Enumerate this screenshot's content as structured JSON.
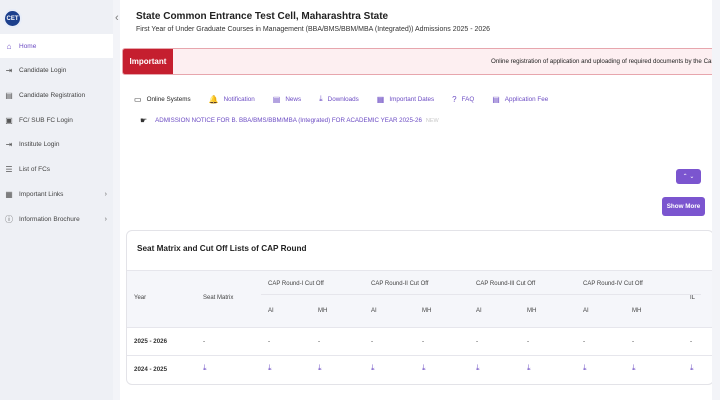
{
  "sidebar": {
    "logo_text": "CET",
    "items": [
      {
        "label": "Home",
        "icon": "home-icon",
        "glyph": "⌂",
        "active": true
      },
      {
        "label": "Candidate Login",
        "icon": "login-icon",
        "glyph": "⇥"
      },
      {
        "label": "Candidate Registration",
        "icon": "registration-icon",
        "glyph": "▤"
      },
      {
        "label": "FC/ SUB FC Login",
        "icon": "building-icon",
        "glyph": "▣"
      },
      {
        "label": "Institute Login",
        "icon": "login-icon",
        "glyph": "⇥"
      },
      {
        "label": "List of FCs",
        "icon": "list-icon",
        "glyph": "☰"
      },
      {
        "label": "Important Links",
        "icon": "link-icon",
        "glyph": "▦",
        "chevron": "›"
      },
      {
        "label": "Information Brochure",
        "icon": "info-icon",
        "glyph": "ⓘ",
        "chevron": "›"
      }
    ]
  },
  "header": {
    "title": "State Common Entrance Test Cell, Maharashtra State",
    "subtitle": "First Year of Under Graduate Courses in Management (BBA/BMS/BBM/MBA (Integrated)) Admissions 2025 - 2026",
    "collapse_glyph": "‹"
  },
  "notice_bar": {
    "label": "Important",
    "text": "Online registration of application and uploading of required documents by the Can"
  },
  "tabs": [
    {
      "label": "Online Systems",
      "icon": "monitor-icon",
      "glyph": "▭",
      "active": true
    },
    {
      "label": "Notification",
      "icon": "bell-icon",
      "glyph": "🔔"
    },
    {
      "label": "News",
      "icon": "newspaper-icon",
      "glyph": "▤"
    },
    {
      "label": "Downloads",
      "icon": "download-icon",
      "glyph": "⤓"
    },
    {
      "label": "Important Dates",
      "icon": "calendar-icon",
      "glyph": "▦"
    },
    {
      "label": "FAQ",
      "icon": "question-icon",
      "glyph": "?"
    },
    {
      "label": "Application Fee",
      "icon": "fee-icon",
      "glyph": "▤"
    }
  ],
  "admission_notice": {
    "hand_glyph": "☛",
    "text": "ADMISSION NOTICE FOR B. BBA/BMS/BBM/MBA (Integrated) FOR ACADEMIC YEAR 2025-26",
    "badge": "NEW"
  },
  "scroll_buttons": "⌃ ⌄",
  "show_more": "Show More",
  "seat_matrix": {
    "title": "Seat Matrix and Cut Off Lists of CAP Round",
    "col_year": "Year",
    "col_seat": "Seat Matrix",
    "rounds": [
      "CAP Round-I Cut Off",
      "CAP Round-II Cut Off",
      "CAP Round-III Cut Off",
      "CAP Round-IV Cut Off"
    ],
    "col_il": "IL",
    "sub_ai": "AI",
    "sub_mh": "MH",
    "rows": [
      {
        "year": "2025 - 2026",
        "cells": [
          "-",
          "-",
          "-",
          "-",
          "-",
          "-",
          "-",
          "-",
          "-",
          "-"
        ],
        "download": false
      },
      {
        "year": "2024 - 2025",
        "cells": [
          "⤓",
          "⤓",
          "⤓",
          "⤓",
          "⤓",
          "⤓",
          "⤓",
          "⤓",
          "⤓",
          "⤓"
        ],
        "download": true
      }
    ]
  },
  "colors": {
    "accent": "#7b55cf",
    "important": "#c51f2f",
    "logo": "#1c3f8c"
  }
}
